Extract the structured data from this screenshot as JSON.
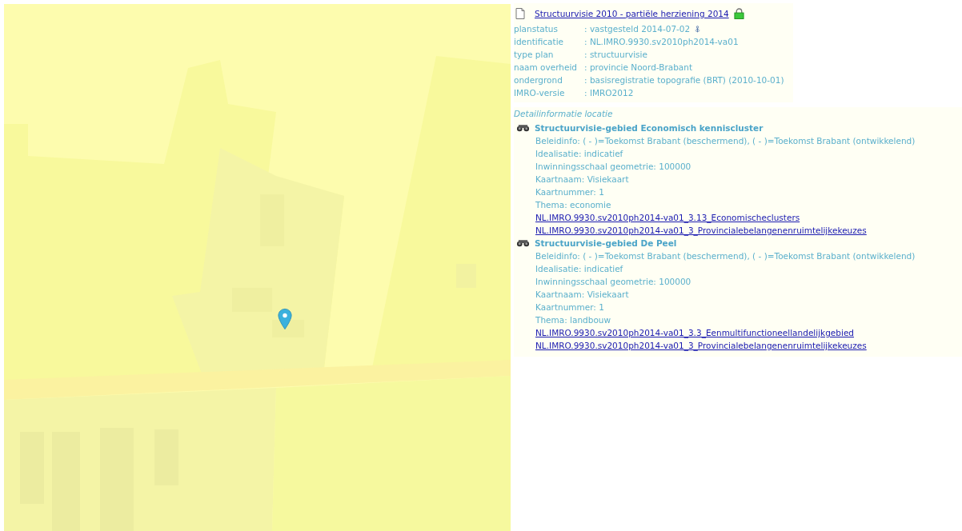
{
  "plan": {
    "title": "Structuurvisie 2010 - partiële herziening 2014",
    "fields": [
      {
        "label": "planstatus",
        "value": ": vastgesteld 2014-07-02",
        "info": true
      },
      {
        "label": "identificatie",
        "value": ": NL.IMRO.9930.sv2010ph2014-va01",
        "info": false
      },
      {
        "label": "type plan",
        "value": ": structuurvisie",
        "info": false
      },
      {
        "label": "naam overheid",
        "value": ": provincie Noord-Brabant",
        "info": false
      },
      {
        "label": "ondergrond",
        "value": ": basisregistratie topografie (BRT) (2010-10-01)",
        "info": false
      },
      {
        "label": "IMRO-versie",
        "value": ": IMRO2012",
        "info": false
      }
    ]
  },
  "detail": {
    "heading": "Detailinformatie locatie",
    "items": [
      {
        "title": "Structuurvisie-gebied Economisch kenniscluster",
        "lines": [
          "Beleidinfo: ( - )=Toekomst Brabant (beschermend), ( - )=Toekomst Brabant (ontwikkelend)",
          "Idealisatie: indicatief",
          "Inwinningsschaal geometrie: 100000",
          "Kaartnaam: Visiekaart",
          "Kaartnummer: 1",
          "Thema: economie"
        ],
        "links": [
          "NL.IMRO.9930.sv2010ph2014-va01_3.13_Economischeclusters",
          "NL.IMRO.9930.sv2010ph2014-va01_3_Provincialebelangenenruimtelijkekeuzes"
        ]
      },
      {
        "title": "Structuurvisie-gebied De Peel",
        "lines": [
          "Beleidinfo: ( - )=Toekomst Brabant (beschermend), ( - )=Toekomst Brabant (ontwikkelend)",
          "Idealisatie: indicatief",
          "Inwinningsschaal geometrie: 100000",
          "Kaartnaam: Visiekaart",
          "Kaartnummer: 1",
          "Thema: landbouw"
        ],
        "links": [
          "NL.IMRO.9930.sv2010ph2014-va01_3.3_Eenmultifunctioneellandelijkgebied",
          "NL.IMRO.9930.sv2010ph2014-va01_3_Provincialebelangenenruimtelijkekeuzes"
        ]
      }
    ]
  }
}
